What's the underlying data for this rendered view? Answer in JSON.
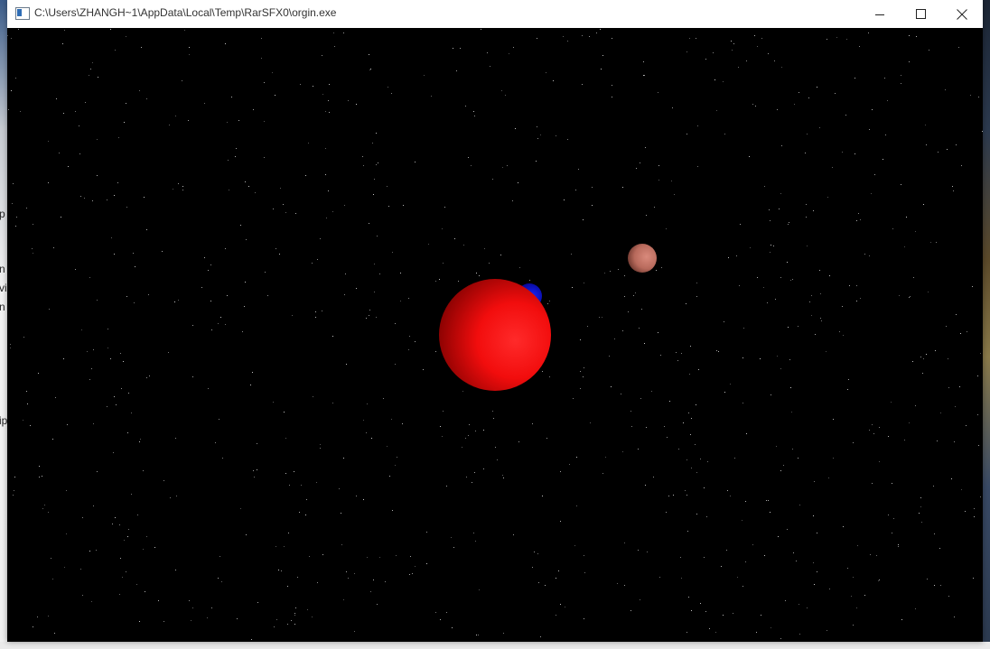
{
  "window": {
    "title": "C:\\Users\\ZHANGH~1\\AppData\\Local\\Temp\\RarSFX0\\orgin.exe",
    "controls": {
      "minimize_icon": "minimize-icon",
      "maximize_icon": "maximize-icon",
      "close_icon": "close-icon"
    }
  },
  "scene": {
    "background_color": "#000000",
    "star_color": "#cfcfcf",
    "bodies": [
      {
        "name": "red-planet",
        "color": "#ff1a1a"
      },
      {
        "name": "blue-moon",
        "color": "#0a14ff"
      },
      {
        "name": "brown-planet",
        "color": "#c7776a"
      }
    ]
  }
}
